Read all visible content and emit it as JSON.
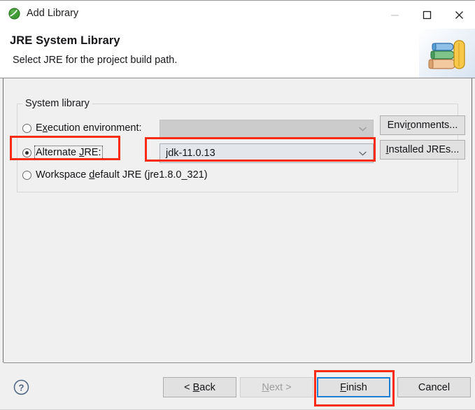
{
  "window": {
    "title": "Add Library",
    "app_icon": "eclipse-green-circle-icon",
    "controls": {
      "minimize": "minimize-icon",
      "maximize": "maximize-icon",
      "close": "close-icon"
    }
  },
  "header": {
    "title": "JRE System Library",
    "subtitle": "Select JRE for the project build path.",
    "graphic": "books-stack-icon"
  },
  "group": {
    "label": "System library",
    "rows": [
      {
        "id": "execution-environment",
        "label_pre": "E",
        "label_accel": "x",
        "label_post": "ecution environment:",
        "checked": false,
        "focused": false,
        "combo_value": "",
        "combo_enabled": false,
        "button": "Environments..."
      },
      {
        "id": "alternate-jre",
        "label_pre": "Alternate ",
        "label_accel": "J",
        "label_post": "RE:",
        "checked": true,
        "focused": true,
        "combo_value": "jdk-11.0.13",
        "combo_enabled": true,
        "button": "Installed JREs..."
      },
      {
        "id": "workspace-default-jre",
        "label_pre": "Workspace ",
        "label_accel": "d",
        "label_post": "efault JRE (jre1.8.0_321)",
        "checked": false,
        "focused": false
      }
    ],
    "buttons": {
      "environments": {
        "pre": "Envi",
        "accel": "r",
        "post": "onments..."
      },
      "installed_jres": {
        "pre": "",
        "accel": "I",
        "post": "nstalled JREs..."
      }
    }
  },
  "footer": {
    "help": "help-icon",
    "back": {
      "pre": "< ",
      "accel": "B",
      "post": "ack"
    },
    "next": {
      "pre": "",
      "accel": "N",
      "post": "ext >"
    },
    "finish": {
      "pre": "",
      "accel": "F",
      "post": "inish"
    },
    "cancel": {
      "pre": "Cancel",
      "accel": "",
      "post": ""
    }
  },
  "annotations": {
    "color": "#fb2a12",
    "targets": [
      "alternate-jre-radio",
      "alternate-jre-combo",
      "finish-button"
    ]
  }
}
